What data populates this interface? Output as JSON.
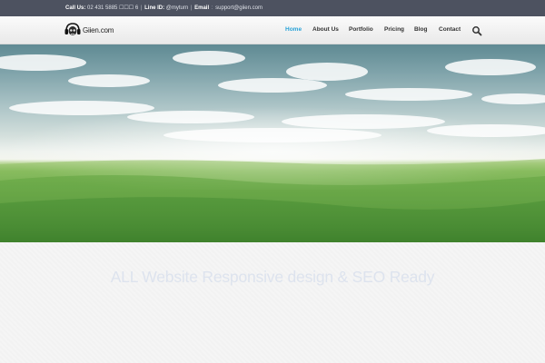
{
  "topbar": {
    "call_label": "Call Us:",
    "call_value": "02 431 5885 ☐☐☐ 6",
    "line_label": "Line ID:",
    "line_value": "@myturn",
    "email_label": "Email",
    "email_value": "support@giien.com"
  },
  "header": {
    "logo_text": "Giien.com",
    "nav": [
      {
        "label": "Home",
        "active": true
      },
      {
        "label": "About Us",
        "active": false
      },
      {
        "label": "Portfolio",
        "active": false
      },
      {
        "label": "Pricing",
        "active": false
      },
      {
        "label": "Blog",
        "active": false
      },
      {
        "label": "Contact",
        "active": false
      }
    ],
    "search_icon": "search-icon"
  },
  "hero": {
    "image": "green-field-under-cloudy-sky",
    "colors": {
      "sky": "#7fa3aa",
      "horizon": "#f3f5ee",
      "grass": "#4f9a36"
    }
  },
  "content": {
    "headline": "ALL Website Responsive design  & SEO Ready"
  },
  "colors": {
    "accent": "#2aa3d8",
    "topbar_bg": "#4d5260"
  }
}
